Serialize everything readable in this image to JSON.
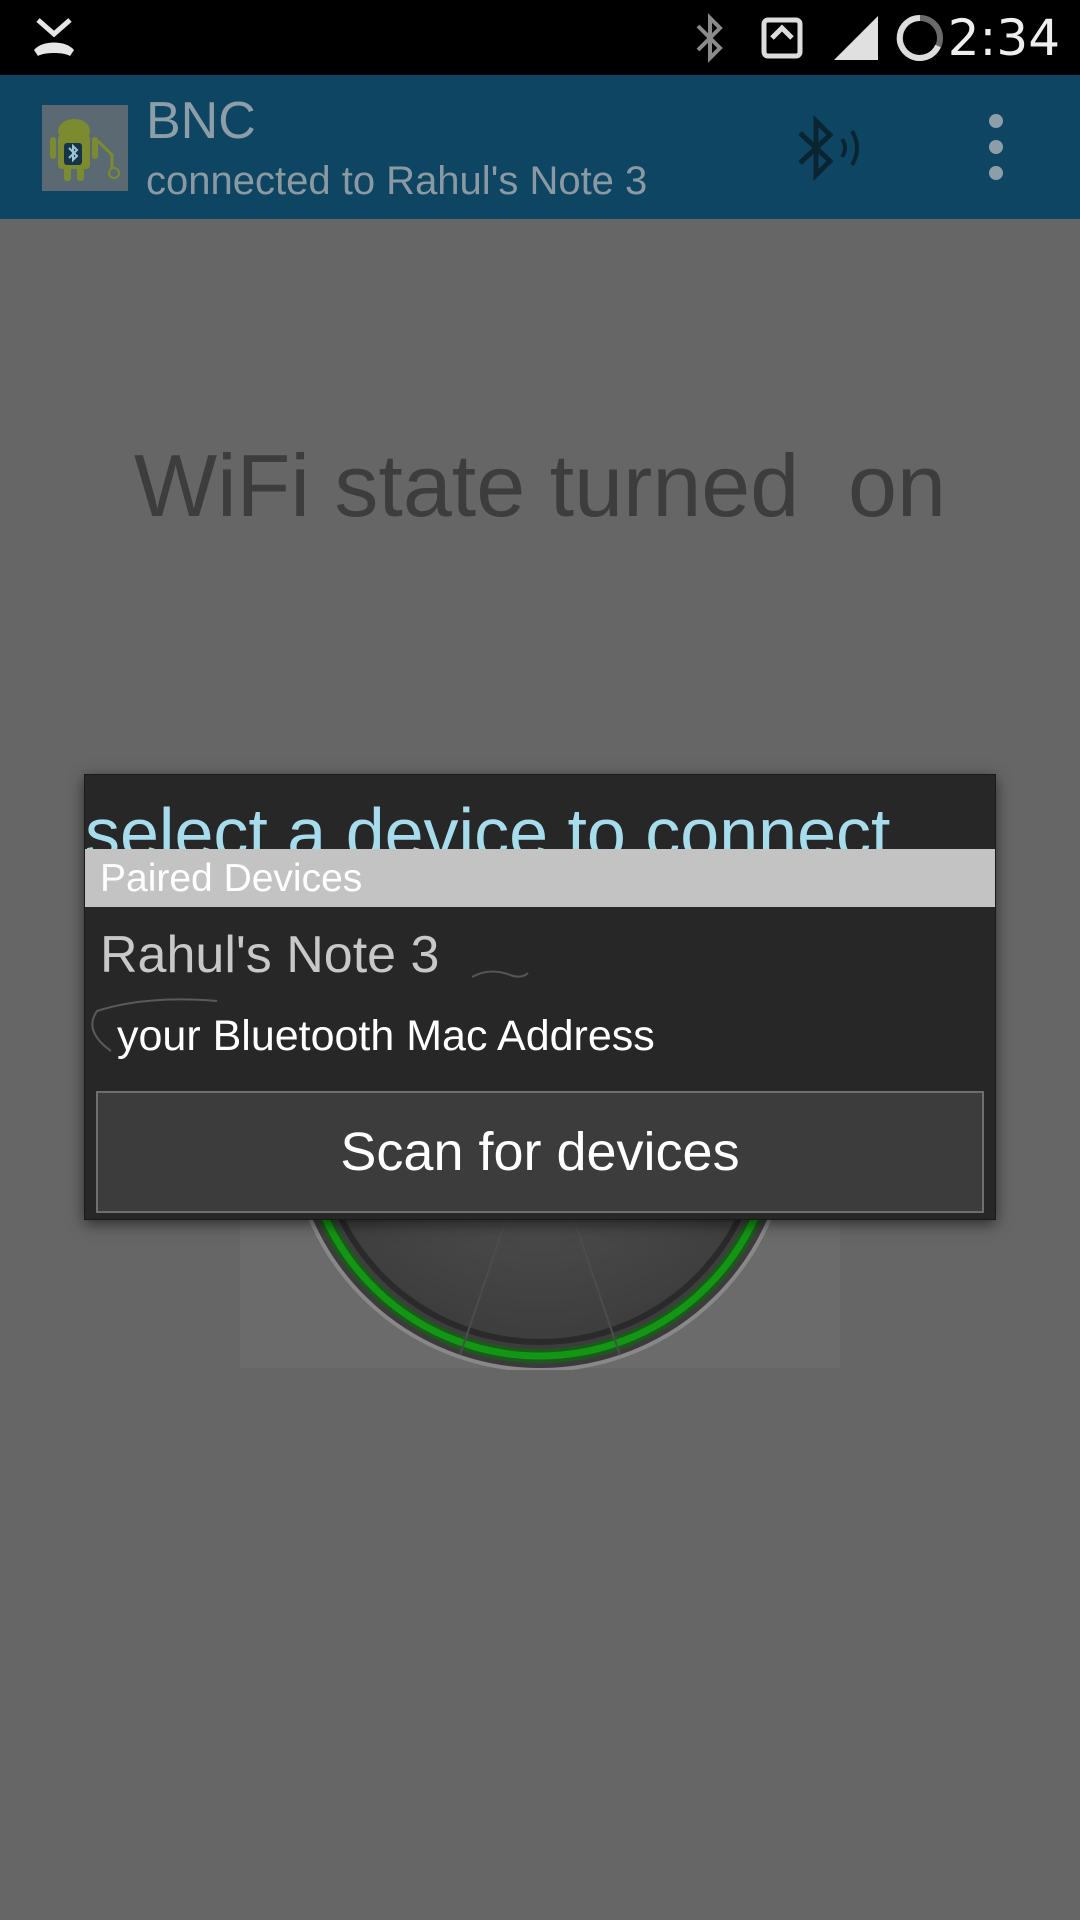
{
  "status_bar": {
    "time": "2:34",
    "icons": [
      "missed-call-icon",
      "bluetooth-icon",
      "sync-icon",
      "signal-icon",
      "battery-icon"
    ]
  },
  "app_bar": {
    "title": "BNC",
    "subtitle": "connected to Rahul's Note 3",
    "actions": [
      "bluetooth-broadcast-icon",
      "overflow-menu-icon"
    ],
    "color": "#0d4563"
  },
  "content": {
    "wifi_status": "WiFi state turned  on"
  },
  "dialog": {
    "title": "select a device to connect",
    "title_color": "#a6dcec",
    "paired_header": "Paired Devices",
    "devices": [
      {
        "name": "Rahul's Note 3"
      }
    ],
    "mac_label": "your Bluetooth Mac Address",
    "scan_button": "Scan for devices"
  }
}
